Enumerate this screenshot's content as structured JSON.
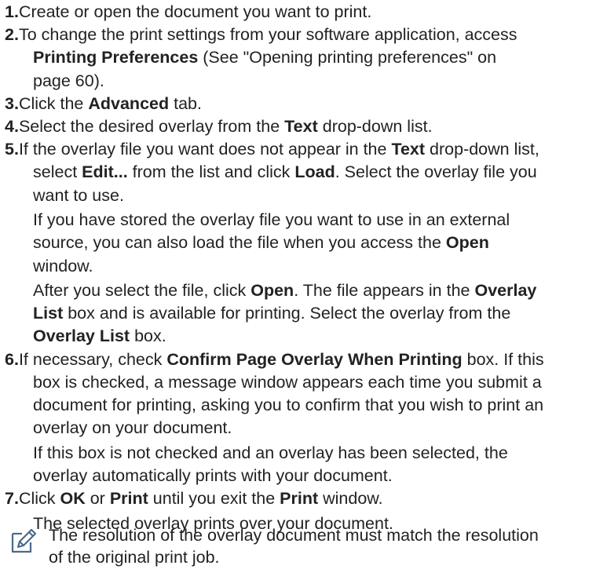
{
  "steps": [
    {
      "number": "1.",
      "lines": [
        [
          {
            "t": "Create or open the document you want to print."
          }
        ]
      ]
    },
    {
      "number": "2.",
      "lines": [
        [
          {
            "t": "To change the print settings from your software application, access"
          }
        ],
        [
          {
            "t": "Printing Preferences",
            "b": true
          },
          {
            "t": " (See \"Opening printing preferences\" on"
          }
        ],
        [
          {
            "t": "page 60)."
          }
        ]
      ]
    },
    {
      "number": "3.",
      "lines": [
        [
          {
            "t": "Click the "
          },
          {
            "t": "Advanced",
            "b": true
          },
          {
            "t": " tab."
          }
        ]
      ]
    },
    {
      "number": "4.",
      "lines": [
        [
          {
            "t": "Select the desired overlay from the "
          },
          {
            "t": "Text",
            "b": true
          },
          {
            "t": " drop-down list."
          }
        ]
      ]
    },
    {
      "number": "5.",
      "lines": [
        [
          {
            "t": "If the overlay file you want does not appear in the "
          },
          {
            "t": "Text",
            "b": true
          },
          {
            "t": " drop-down list,"
          }
        ],
        [
          {
            "t": "select "
          },
          {
            "t": "Edit...",
            "b": true
          },
          {
            "t": " from the list and click "
          },
          {
            "t": "Load",
            "b": true
          },
          {
            "t": ". Select the overlay file you"
          }
        ],
        [
          {
            "t": "want to use."
          }
        ]
      ],
      "paragraphs": [
        [
          [
            {
              "t": "If you have stored the overlay file you want to use in an external"
            }
          ],
          [
            {
              "t": "source, you can also load the file when you access the "
            },
            {
              "t": "Open",
              "b": true
            }
          ],
          [
            {
              "t": "window."
            }
          ]
        ],
        [
          [
            {
              "t": "After you select the file, click "
            },
            {
              "t": "Open",
              "b": true
            },
            {
              "t": ". The file appears in the "
            },
            {
              "t": "Overlay",
              "b": true
            }
          ],
          [
            {
              "t": "List",
              "b": true
            },
            {
              "t": " box and is available for printing. Select the overlay from the"
            }
          ],
          [
            {
              "t": "Overlay List",
              "b": true
            },
            {
              "t": " box."
            }
          ]
        ]
      ]
    },
    {
      "number": "6.",
      "lines": [
        [
          {
            "t": "If necessary, check "
          },
          {
            "t": "Confirm Page Overlay When Printing",
            "b": true
          },
          {
            "t": " box. If this"
          }
        ],
        [
          {
            "t": "box is checked, a message window appears each time you submit a"
          }
        ],
        [
          {
            "t": "document for printing, asking you to confirm that you wish to print an"
          }
        ],
        [
          {
            "t": "overlay on your document."
          }
        ]
      ],
      "paragraphs": [
        [
          [
            {
              "t": "If this box is not checked and an overlay has been selected, the"
            }
          ],
          [
            {
              "t": "overlay automatically prints with your document."
            }
          ]
        ]
      ]
    },
    {
      "number": "7.",
      "lines": [
        [
          {
            "t": "Click "
          },
          {
            "t": "OK",
            "b": true
          },
          {
            "t": " or "
          },
          {
            "t": "Print",
            "b": true
          },
          {
            "t": " until you exit the "
          },
          {
            "t": "Print",
            "b": true
          },
          {
            "t": " window."
          }
        ]
      ],
      "paragraphs": [
        [
          [
            {
              "t": "The selected overlay prints over your document."
            }
          ]
        ]
      ]
    }
  ],
  "note": {
    "icon": "note-pencil-icon",
    "lines": [
      "The resolution of the overlay document must match the resolution",
      "of the original print job."
    ],
    "color": "#4a6a8a"
  }
}
